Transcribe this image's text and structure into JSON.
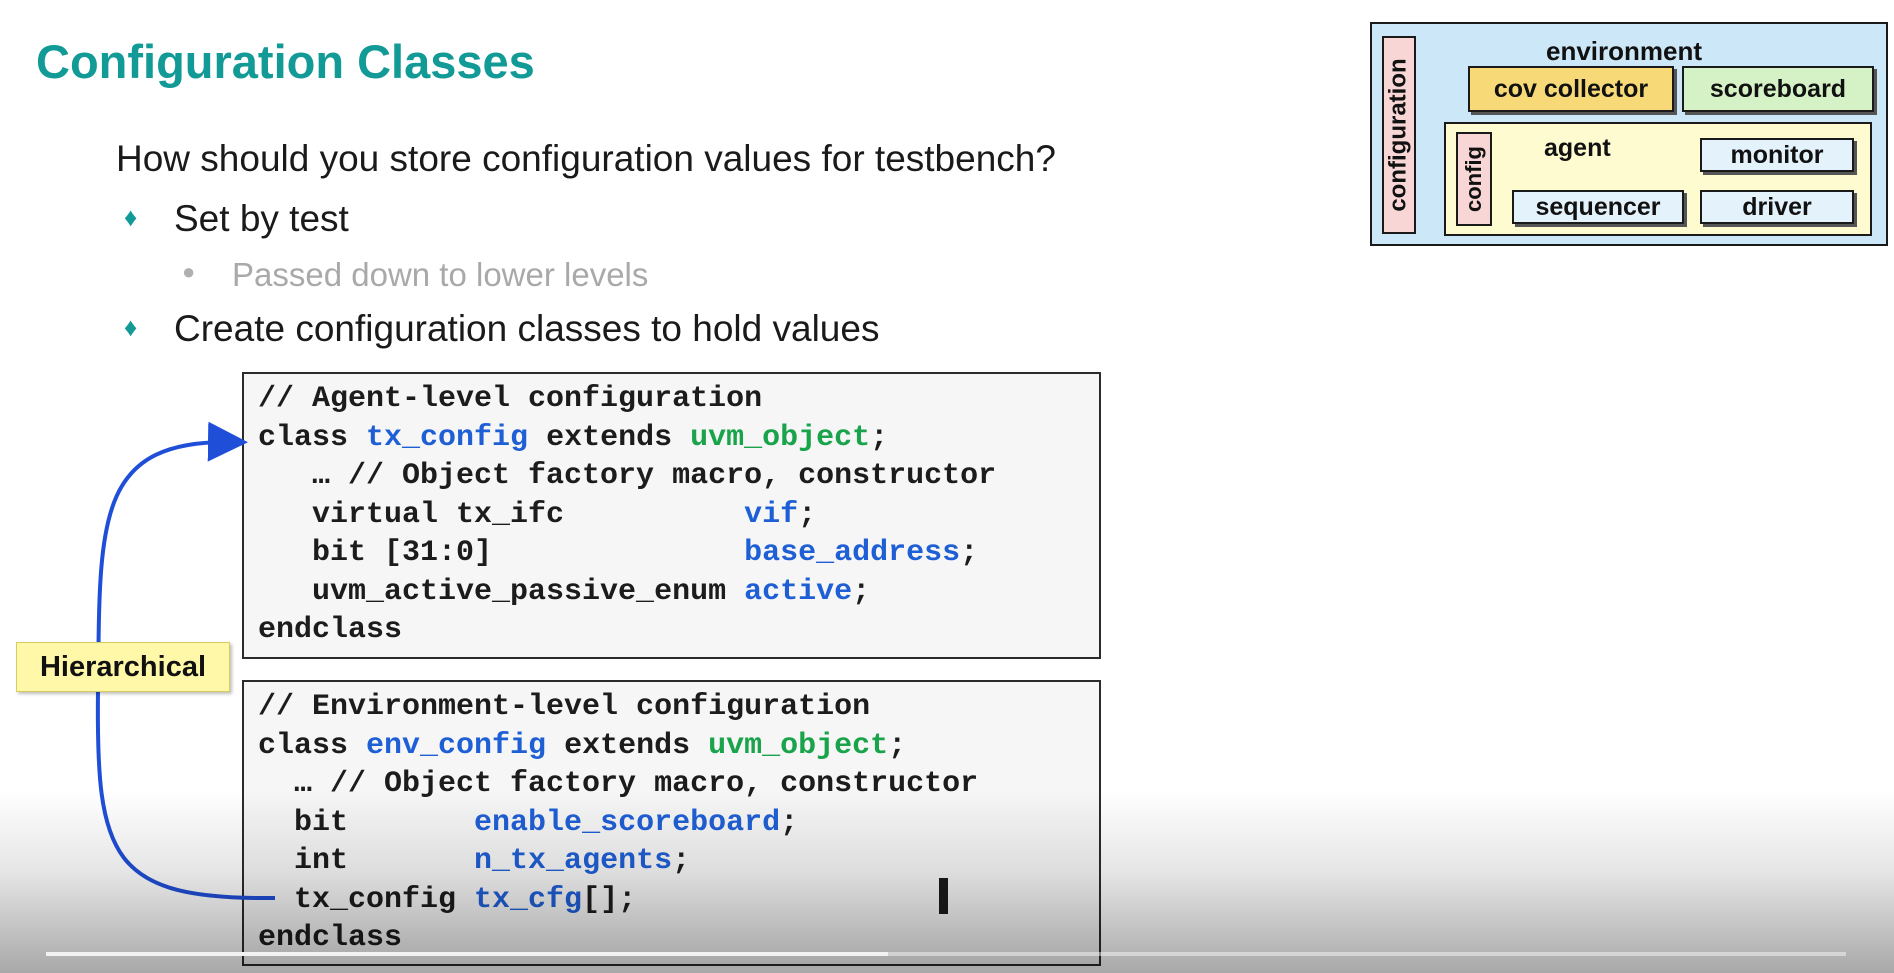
{
  "slide": {
    "title": "Configuration Classes",
    "question": "How should you store configuration values for testbench?",
    "bullets": [
      {
        "text": "Set by test",
        "subs": [
          "Passed down to lower levels"
        ]
      },
      {
        "text": "Create configuration classes to hold values",
        "subs": []
      }
    ],
    "hierarchical_label": "Hierarchical",
    "bullet_marker": "♦",
    "sub_marker": "●"
  },
  "code_agent": {
    "lines": [
      [
        {
          "t": "// Agent-level configuration"
        }
      ],
      [
        {
          "t": "class "
        },
        {
          "t": "tx_config",
          "c": "blue"
        },
        {
          "t": " extends "
        },
        {
          "t": "uvm_object",
          "c": "green"
        },
        {
          "t": ";"
        }
      ],
      [
        {
          "t": "   … // Object factory macro, constructor"
        }
      ],
      [
        {
          "t": "   virtual tx_ifc          "
        },
        {
          "t": "vif",
          "c": "blue"
        },
        {
          "t": ";"
        }
      ],
      [
        {
          "t": "   bit [31:0]              "
        },
        {
          "t": "base_address",
          "c": "blue"
        },
        {
          "t": ";"
        }
      ],
      [
        {
          "t": "   uvm_active_passive_enum "
        },
        {
          "t": "active",
          "c": "blue"
        },
        {
          "t": ";"
        }
      ],
      [
        {
          "t": "endclass"
        }
      ]
    ]
  },
  "code_env": {
    "lines": [
      [
        {
          "t": "// Environment-level configuration"
        }
      ],
      [
        {
          "t": "class "
        },
        {
          "t": "env_config",
          "c": "blue"
        },
        {
          "t": " extends "
        },
        {
          "t": "uvm_object",
          "c": "green"
        },
        {
          "t": ";"
        }
      ],
      [
        {
          "t": "  … // Object factory macro, constructor"
        }
      ],
      [
        {
          "t": "  bit       "
        },
        {
          "t": "enable_scoreboard",
          "c": "blue"
        },
        {
          "t": ";"
        }
      ],
      [
        {
          "t": "  int       "
        },
        {
          "t": "n_tx_agents",
          "c": "blue"
        },
        {
          "t": ";"
        }
      ],
      [
        {
          "t": "  tx_config "
        },
        {
          "t": "tx_cfg",
          "c": "blue"
        },
        {
          "t": "[];"
        }
      ],
      [
        {
          "t": "endclass"
        }
      ]
    ]
  },
  "diagram": {
    "configuration_label": "configuration",
    "environment_label": "environment",
    "cov_collector_label": "cov collector",
    "scoreboard_label": "scoreboard",
    "config_label": "config",
    "agent_label": "agent",
    "monitor_label": "monitor",
    "sequencer_label": "sequencer",
    "driver_label": "driver"
  },
  "video": {
    "progress": 0.468
  },
  "colors": {
    "title": "#119a96",
    "code_blue": "#1f5fd6",
    "code_green": "#19a34a",
    "arrow": "#1f4fd8",
    "diagram_bg": "#cce7f7",
    "agent_bg": "#fdfbcf",
    "config_bg": "#f9d6d6",
    "cov_collector_bg": "#f7d977",
    "scoreboard_bg": "#d4f2c6",
    "component_bg": "#e4f2fb"
  }
}
